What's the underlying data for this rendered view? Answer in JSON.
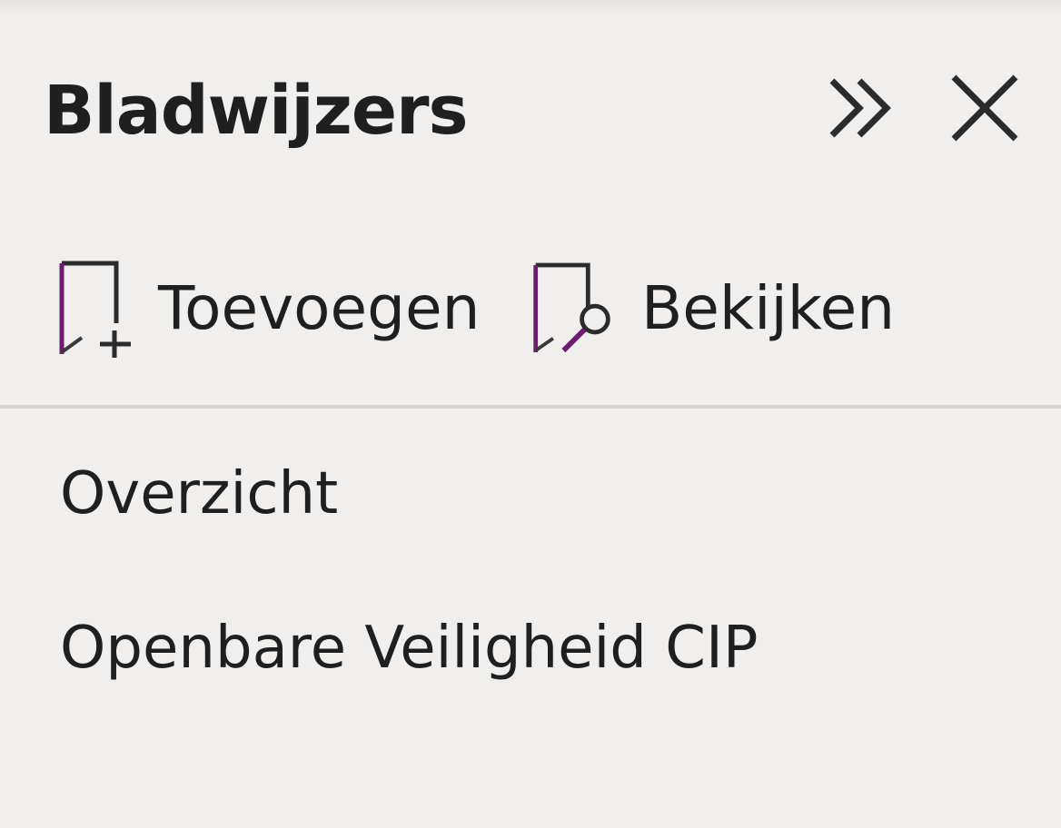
{
  "panel": {
    "title": "Bladwijzers",
    "header_icons": {
      "expand": "chevron-double-right-icon",
      "close": "close-icon"
    }
  },
  "toolbar": {
    "add_label": "Toevoegen",
    "add_icon": "bookmark-add-icon",
    "view_label": "Bekijken",
    "view_icon": "bookmark-search-icon"
  },
  "bookmarks": [
    {
      "label": "Overzicht"
    },
    {
      "label": "Openbare Veiligheid CIP"
    }
  ],
  "colors": {
    "background": "#f0efee",
    "text": "#1f1f1f",
    "icon_accent": "#6b1d6f",
    "divider": "#d6d5d4"
  }
}
